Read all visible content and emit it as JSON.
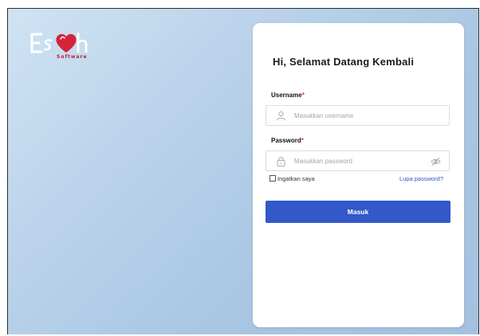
{
  "brand": {
    "logo_text": "Es h",
    "logo_sub": "Software"
  },
  "card": {
    "title": "Hi, Selamat Datang Kembali",
    "username": {
      "label": "Username",
      "required_mark": "*",
      "placeholder": "Masukkan username"
    },
    "password": {
      "label": "Password",
      "required_mark": "*",
      "placeholder": "Masukkan password"
    },
    "remember_label": "Ingatkan saya",
    "forgot_label": "Lupa password?",
    "submit_label": "Masuk"
  },
  "colors": {
    "accent": "#3258c9",
    "link": "#2b56c4",
    "required": "#e53935",
    "logo_heart": "#d3243a"
  },
  "icons": [
    "user-icon",
    "lock-icon",
    "eye-off-icon",
    "heart-icon"
  ]
}
